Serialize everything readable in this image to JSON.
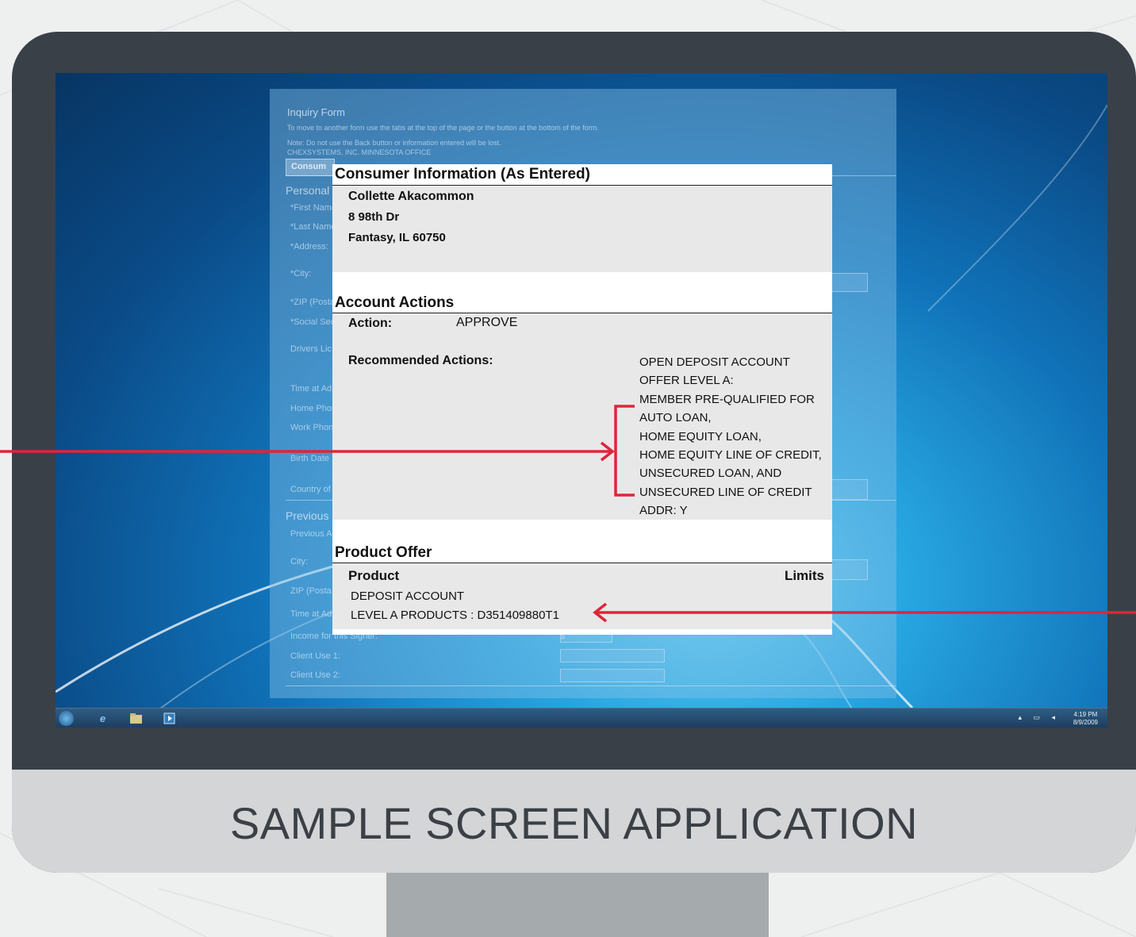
{
  "caption": "SAMPLE SCREEN APPLICATION",
  "colors": {
    "accent": "#e0243a",
    "monitor_frame": "#3a4048",
    "monitor_chin": "#d3d5d6"
  },
  "background_form": {
    "title": "Inquiry Form",
    "instructions": "To move to another form use the tabs at the top of the page or the button at the bottom of the form.",
    "note": "Note: Do not use the Back button or information entered will be lost.",
    "office": "CHEXSYSTEMS, INC. MINNESOTA OFFICE",
    "tab": "Consum",
    "section_personal": "Personal",
    "fields": [
      "*First Name",
      "*Last Name",
      "*Address:",
      "*City:",
      "*ZIP (Posta",
      "*Social Sec",
      "Drivers Lic",
      "Time at Ad",
      "Home Phon",
      "Work Phon",
      "Birth Date",
      "Country of"
    ],
    "section_previous": "Previous",
    "prev_fields": [
      "Previous A",
      "City:",
      "ZIP (Posta",
      "Time at Ad",
      "Income for this Signer:",
      "Client Use 1:",
      "Client Use 2:"
    ],
    "currency_symbol": "$"
  },
  "taskbar": {
    "time": "4:19 PM",
    "date": "8/9/2009"
  },
  "report": {
    "consumer": {
      "title": "Consumer Information (As Entered)",
      "name": "Collette Akacommon",
      "street": "8 98th Dr",
      "city_state_zip": "Fantasy, IL 60750"
    },
    "actions": {
      "title": "Account Actions",
      "action_label": "Action:",
      "action_value": "APPROVE",
      "recommended_label": "Recommended Actions:",
      "recommended": [
        "OPEN DEPOSIT ACCOUNT",
        "OFFER LEVEL A:",
        "MEMBER PRE-QUALIFIED FOR",
        "AUTO LOAN,",
        "HOME EQUITY LOAN,",
        "HOME EQUITY LINE OF CREDIT,",
        "UNSECURED LOAN, AND",
        "UNSECURED LINE OF CREDIT",
        "ADDR: Y"
      ]
    },
    "product": {
      "title": "Product Offer",
      "col_product": "Product",
      "col_limits": "Limits",
      "items": [
        "DEPOSIT ACCOUNT",
        "LEVEL A PRODUCTS : D351409880T1"
      ]
    }
  }
}
